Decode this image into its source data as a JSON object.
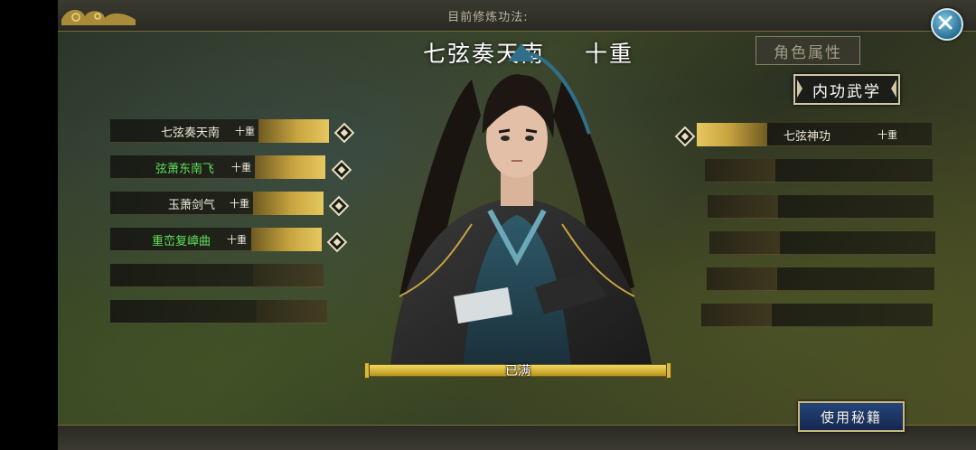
{
  "header": {
    "training_label": "目前修炼功法:"
  },
  "current_skill": {
    "name": "七弦奏天南",
    "level": "十重"
  },
  "tabs": {
    "attributes": "角色属性",
    "inner_martial": "内功武学"
  },
  "left_skills": [
    {
      "name": "七弦奏天南",
      "level": "十重",
      "color": "#f0ead8"
    },
    {
      "name": "弦萧东南飞",
      "level": "十重",
      "color": "#5ee05a"
    },
    {
      "name": "玉萧剑气",
      "level": "十重",
      "color": "#f0ead8"
    },
    {
      "name": "重峦复嶂曲",
      "level": "十重",
      "color": "#5ee05a"
    }
  ],
  "right_skills": [
    {
      "name": "七弦神功",
      "level": "十重",
      "color": "#f0ead8"
    }
  ],
  "progress": {
    "label": "已满",
    "fraction": 1.0
  },
  "buttons": {
    "use_manual": "使用秘籍"
  },
  "icons": {
    "close": "close-icon",
    "select": "diamond-icon",
    "ornament": "cloud-ornament-icon"
  },
  "colors": {
    "gold": "#c8a440",
    "highlight_green": "#5ee05a",
    "button_blue": "#24447a"
  }
}
